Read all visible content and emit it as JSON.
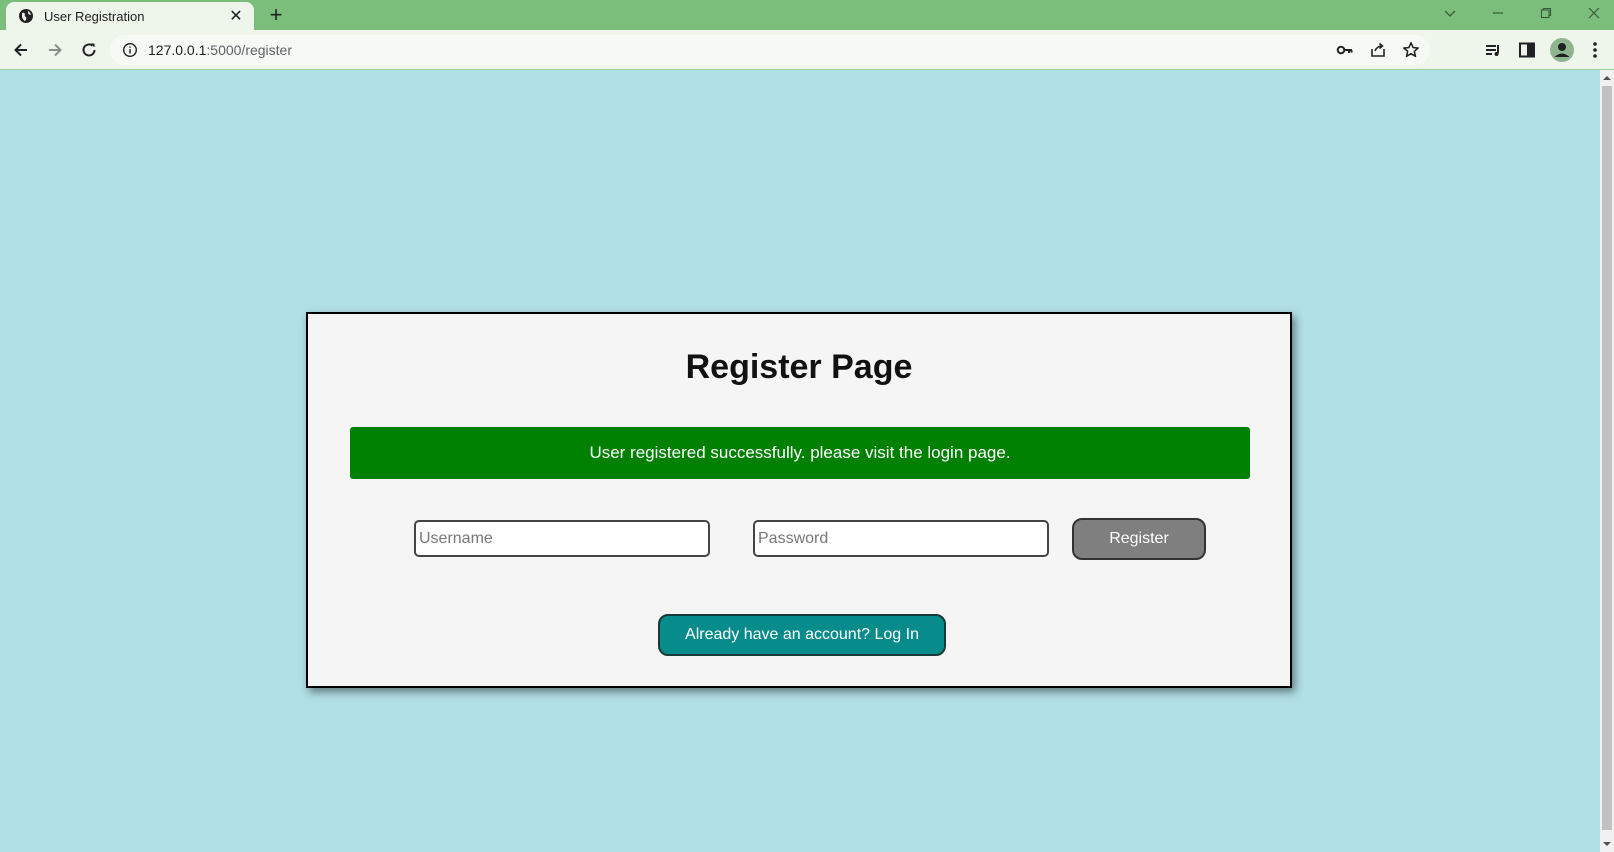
{
  "browser": {
    "tab_title": "User Registration",
    "tab_close": "✕",
    "new_tab": "+",
    "url_host": "127.0.0.1",
    "url_path": ":5000/register"
  },
  "page": {
    "title": "Register Page",
    "alert_message": "User registered successfully. please visit the login page.",
    "username_placeholder": "Username",
    "password_placeholder": "Password",
    "register_label": "Register",
    "login_label": "Already have an account? Log In"
  },
  "colors": {
    "page_background": "#b0dfe5",
    "card_background": "#f5f5f5",
    "alert_success": "#008000",
    "register_button": "#7f7f7f",
    "login_button": "#078b8b",
    "tabbar": "#7bbd7b"
  },
  "icons": {
    "tab_favicon": "globe-icon",
    "back": "arrow-left-icon",
    "forward": "arrow-right-icon",
    "reload": "reload-icon",
    "site_info": "info-icon",
    "password_key": "key-icon",
    "share": "share-icon",
    "bookmark": "star-icon",
    "media": "media-queue-icon",
    "side_panel": "side-panel-icon",
    "profile": "profile-icon",
    "menu": "kebab-menu-icon"
  }
}
